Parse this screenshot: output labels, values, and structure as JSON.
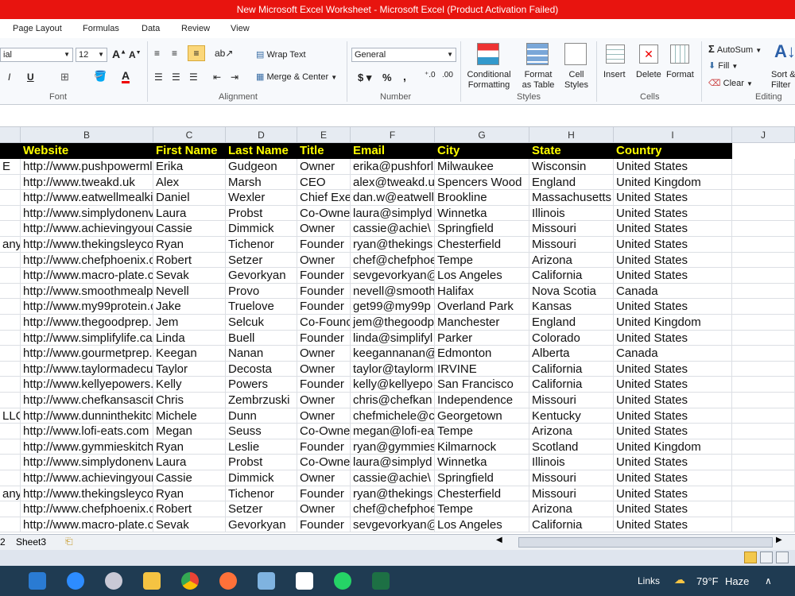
{
  "window": {
    "title": "New Microsoft Excel Worksheet  -  Microsoft Excel (Product Activation Failed)"
  },
  "menu": [
    "Page Layout",
    "Formulas",
    "Data",
    "Review",
    "View"
  ],
  "ribbon": {
    "font_name": "ial",
    "font_size": "12",
    "wrap_text": "Wrap Text",
    "merge_center": "Merge & Center",
    "number_format": "General",
    "conditional_formatting": [
      "Conditional",
      "Formatting"
    ],
    "format_as_table": [
      "Format",
      "as Table"
    ],
    "cell_styles": [
      "Cell",
      "Styles"
    ],
    "insert": "Insert",
    "delete": "Delete",
    "format": "Format",
    "autosum": "AutoSum",
    "fill": "Fill",
    "clear": "Clear",
    "sort_filter": [
      "Sort &",
      "Filter"
    ],
    "groups": {
      "font": "Font",
      "alignment": "Alignment",
      "number": "Number",
      "styles": "Styles",
      "cells": "Cells",
      "editing": "Editing"
    }
  },
  "columns": [
    "B",
    "C",
    "D",
    "E",
    "F",
    "G",
    "H",
    "I",
    "J"
  ],
  "headers": [
    "Website",
    "First Name",
    "Last Name",
    "Title",
    "Email",
    "City",
    "State",
    "Country"
  ],
  "rows": [
    [
      "E",
      "http://www.pushpowerml",
      "Erika",
      "Gudgeon",
      "Owner",
      "erika@pushforl",
      "Milwaukee",
      "Wisconsin",
      "United States"
    ],
    [
      "",
      "http://www.tweakd.uk",
      "Alex",
      "Marsh",
      "CEO",
      "alex@tweakd.u",
      "Spencers Wood",
      "England",
      "United Kingdom"
    ],
    [
      "",
      "http://www.eatwellmealki",
      "Daniel",
      "Wexler",
      "Chief Exe",
      "dan.w@eatwell",
      "Brookline",
      "Massachusetts",
      "United States"
    ],
    [
      "",
      "http://www.simplydonenv",
      "Laura",
      "Probst",
      "Co-Owne",
      "laura@simplyd",
      "Winnetka",
      "Illinois",
      "United States"
    ],
    [
      "",
      "http://www.achievingyour",
      "Cassie",
      "Dimmick",
      "Owner",
      "cassie@achie\\",
      "Springfield",
      "Missouri",
      "United States"
    ],
    [
      "any",
      "http://www.thekingsleyco",
      "Ryan",
      "Tichenor",
      "Founder",
      "ryan@thekings",
      "Chesterfield",
      "Missouri",
      "United States"
    ],
    [
      "",
      "http://www.chefphoenix.c",
      "Robert",
      "Setzer",
      "Owner",
      "chef@chefphoe",
      "Tempe",
      "Arizona",
      "United States"
    ],
    [
      "",
      "http://www.macro-plate.c",
      "Sevak",
      "Gevorkyan",
      "Founder",
      "sevgevorkyan@",
      "Los Angeles",
      "California",
      "United States"
    ],
    [
      "",
      "http://www.smoothmealp",
      "Nevell",
      "Provo",
      "Founder",
      "nevell@smooth",
      "Halifax",
      "Nova Scotia",
      "Canada"
    ],
    [
      "",
      "http://www.my99protein.c",
      "Jake",
      "Truelove",
      "Founder",
      "get99@my99p",
      "Overland Park",
      "Kansas",
      "United States"
    ],
    [
      "",
      "http://www.thegoodprep.",
      "Jem",
      "Selcuk",
      "Co-Founc",
      "jem@thegoodp",
      "Manchester",
      "England",
      "United Kingdom"
    ],
    [
      "",
      "http://www.simplifylife.ca",
      "Linda",
      "Buell",
      "Founder",
      "linda@simplifyl",
      "Parker",
      "Colorado",
      "United States"
    ],
    [
      "",
      "http://www.gourmetprep.",
      "Keegan",
      "Nanan",
      "Owner",
      "keegannanan@",
      "Edmonton",
      "Alberta",
      "Canada"
    ],
    [
      "",
      "http://www.taylormadecu",
      "Taylor",
      "Decosta",
      "Owner",
      "taylor@taylorm",
      "IRVINE",
      "California",
      "United States"
    ],
    [
      "",
      "http://www.kellyepowers.",
      "Kelly",
      "Powers",
      "Founder",
      "kelly@kellyepo",
      "San Francisco",
      "California",
      "United States"
    ],
    [
      "",
      "http://www.chefkansascit",
      "Chris",
      "Zembrzuski",
      "Owner",
      "chris@chefkan",
      "Independence",
      "Missouri",
      "United States"
    ],
    [
      "LLC",
      "http://www.dunninthekitcl",
      "Michele",
      "Dunn",
      "Owner",
      "chefmichele@c",
      "Georgetown",
      "Kentucky",
      "United States"
    ],
    [
      "",
      "http://www.lofi-eats.com",
      "Megan",
      "Seuss",
      "Co-Owne",
      "megan@lofi-ea",
      "Tempe",
      "Arizona",
      "United States"
    ],
    [
      "",
      "http://www.gymmieskitch",
      "Ryan",
      "Leslie",
      "Founder",
      "ryan@gymmies",
      "Kilmarnock",
      "Scotland",
      "United Kingdom"
    ],
    [
      "",
      "http://www.simplydonenv",
      "Laura",
      "Probst",
      "Co-Owne",
      "laura@simplyd",
      "Winnetka",
      "Illinois",
      "United States"
    ],
    [
      "",
      "http://www.achievingyour",
      "Cassie",
      "Dimmick",
      "Owner",
      "cassie@achie\\",
      "Springfield",
      "Missouri",
      "United States"
    ],
    [
      "any",
      "http://www.thekingsleyco",
      "Ryan",
      "Tichenor",
      "Founder",
      "ryan@thekings",
      "Chesterfield",
      "Missouri",
      "United States"
    ],
    [
      "",
      "http://www.chefphoenix.c",
      "Robert",
      "Setzer",
      "Owner",
      "chef@chefphoe",
      "Tempe",
      "Arizona",
      "United States"
    ],
    [
      "",
      "http://www.macro-plate.c",
      "Sevak",
      "Gevorkyan",
      "Founder",
      "sevgevorkyan@",
      "Los Angeles",
      "California",
      "United States"
    ]
  ],
  "sheet_tabs": [
    "2",
    "Sheet3"
  ],
  "taskbar": {
    "links": "Links",
    "weather_temp": "79°F",
    "weather_desc": "Haze"
  },
  "colors": {
    "titlebar": "#e8140f",
    "header_bg": "#000000",
    "header_text": "#ffff00",
    "taskbar": "#1f3b52"
  }
}
